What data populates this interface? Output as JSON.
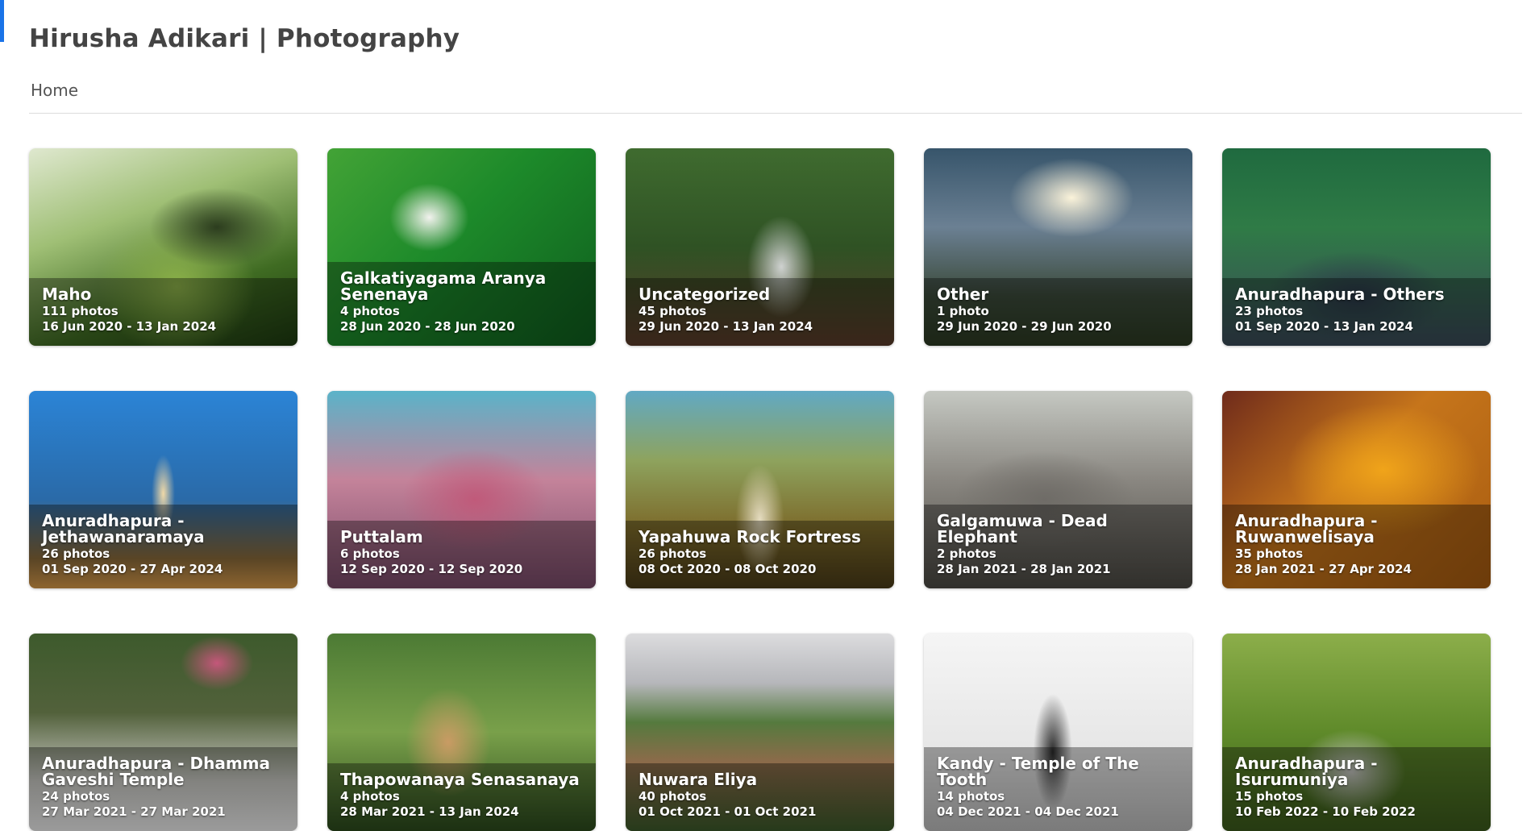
{
  "site": {
    "title": "Hirusha Adikari | Photography",
    "accent_color": "#1a73e8"
  },
  "breadcrumb": {
    "home_label": "Home"
  },
  "albums": [
    {
      "title": "Maho",
      "count": "111 photos",
      "dates": "16 Jun 2020 - 13 Jan 2024"
    },
    {
      "title": "Galkatiyagama Aranya Senenaya",
      "count": "4 photos",
      "dates": "28 Jun 2020 - 28 Jun 2020"
    },
    {
      "title": "Uncategorized",
      "count": "45 photos",
      "dates": "29 Jun 2020 - 13 Jan 2024"
    },
    {
      "title": "Other",
      "count": "1 photo",
      "dates": "29 Jun 2020 - 29 Jun 2020"
    },
    {
      "title": "Anuradhapura - Others",
      "count": "23 photos",
      "dates": "01 Sep 2020 - 13 Jan 2024"
    },
    {
      "title": "Anuradhapura - Jethawanaramaya",
      "count": "26 photos",
      "dates": "01 Sep 2020 - 27 Apr 2024"
    },
    {
      "title": "Puttalam",
      "count": "6 photos",
      "dates": "12 Sep 2020 - 12 Sep 2020"
    },
    {
      "title": "Yapahuwa Rock Fortress",
      "count": "26 photos",
      "dates": "08 Oct 2020 - 08 Oct 2020"
    },
    {
      "title": "Galgamuwa - Dead Elephant",
      "count": "2 photos",
      "dates": "28 Jan 2021 - 28 Jan 2021"
    },
    {
      "title": "Anuradhapura - Ruwanwelisaya",
      "count": "35 photos",
      "dates": "28 Jan 2021 - 27 Apr 2024"
    },
    {
      "title": "Anuradhapura - Dhamma Gaveshi Temple",
      "count": "24 photos",
      "dates": "27 Mar 2021 - 27 Mar 2021"
    },
    {
      "title": "Thapowanaya Senasanaya",
      "count": "4 photos",
      "dates": "28 Mar 2021 - 13 Jan 2024"
    },
    {
      "title": "Nuwara Eliya",
      "count": "40 photos",
      "dates": "01 Oct 2021 - 01 Oct 2021"
    },
    {
      "title": "Kandy - Temple of The Tooth",
      "count": "14 photos",
      "dates": "04 Dec 2021 - 04 Dec 2021"
    },
    {
      "title": "Anuradhapura - Isurumuniya",
      "count": "15 photos",
      "dates": "10 Feb 2022 - 10 Feb 2022"
    }
  ]
}
